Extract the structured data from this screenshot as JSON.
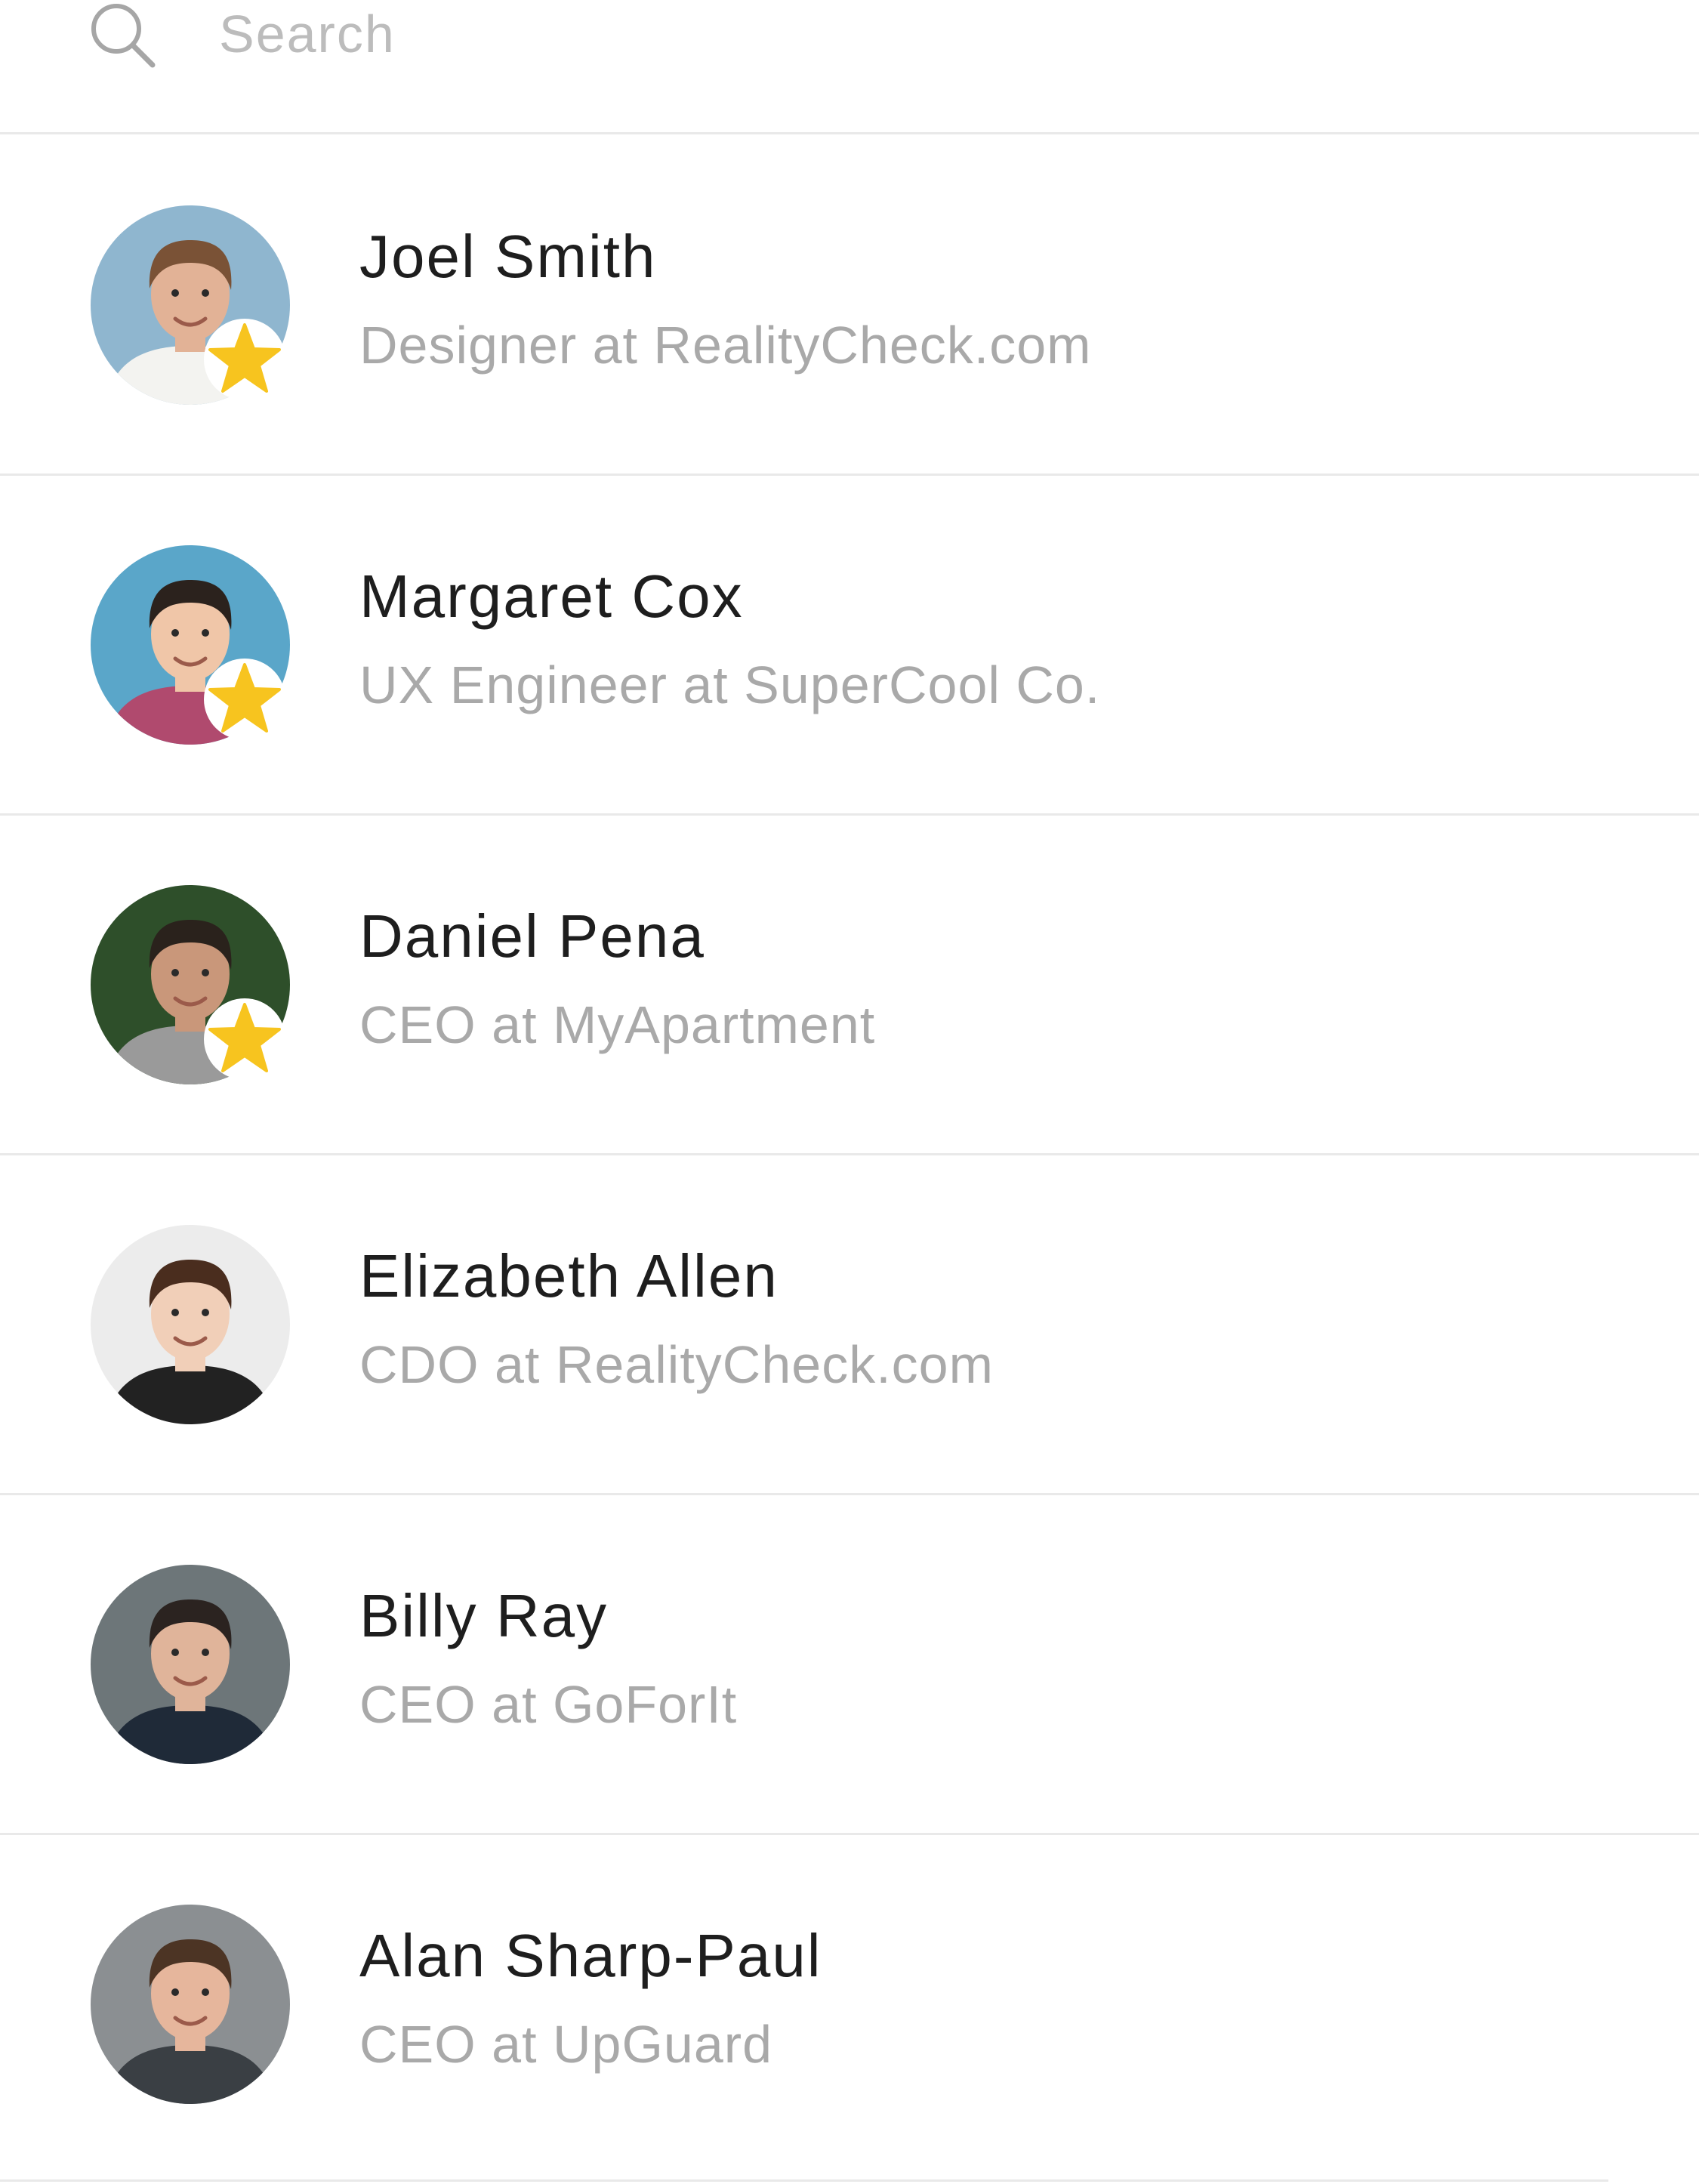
{
  "search": {
    "placeholder": "Search",
    "value": "",
    "icon": "search-icon"
  },
  "contacts": [
    {
      "name": "Joel Smith",
      "role": "Designer at RealityCheck.com",
      "starred": true,
      "avatar_colors": {
        "bg": "#8fb6cf",
        "skin": "#e2b296",
        "hair": "#7a5236",
        "shirt": "#f3f3f0"
      }
    },
    {
      "name": "Margaret Cox",
      "role": "UX Engineer at SuperCool Co.",
      "starred": true,
      "avatar_colors": {
        "bg": "#5aa6c9",
        "skin": "#f0c6a8",
        "hair": "#2b221d",
        "shirt": "#b04a6e"
      }
    },
    {
      "name": "Daniel Pena",
      "role": "CEO at MyApartment",
      "starred": true,
      "avatar_colors": {
        "bg": "#2e4f2a",
        "skin": "#c9977a",
        "hair": "#2a221c",
        "shirt": "#9a9a9a"
      }
    },
    {
      "name": "Elizabeth Allen",
      "role": "CDO at RealityCheck.com",
      "starred": false,
      "avatar_colors": {
        "bg": "#ececec",
        "skin": "#f1cfb8",
        "hair": "#4a2d1e",
        "shirt": "#222222"
      }
    },
    {
      "name": "Billy Ray",
      "role": "CEO at GoForIt",
      "starred": false,
      "avatar_colors": {
        "bg": "#6d7679",
        "skin": "#e0b49a",
        "hair": "#2b2320",
        "shirt": "#1f2a38"
      }
    },
    {
      "name": "Alan Sharp-Paul",
      "role": "CEO at UpGuard",
      "starred": false,
      "avatar_colors": {
        "bg": "#8b8f92",
        "skin": "#e6b69c",
        "hair": "#4c3424",
        "shirt": "#3a3f44"
      }
    }
  ],
  "badge": {
    "icon": "star-icon",
    "color": "#f7c41f"
  },
  "colors": {
    "divider": "#e9e9e9",
    "name_text": "#1e1e1e",
    "role_text": "#a9a9a9",
    "placeholder_text": "#bcbcbc",
    "icon_gray": "#a6a6a6"
  }
}
